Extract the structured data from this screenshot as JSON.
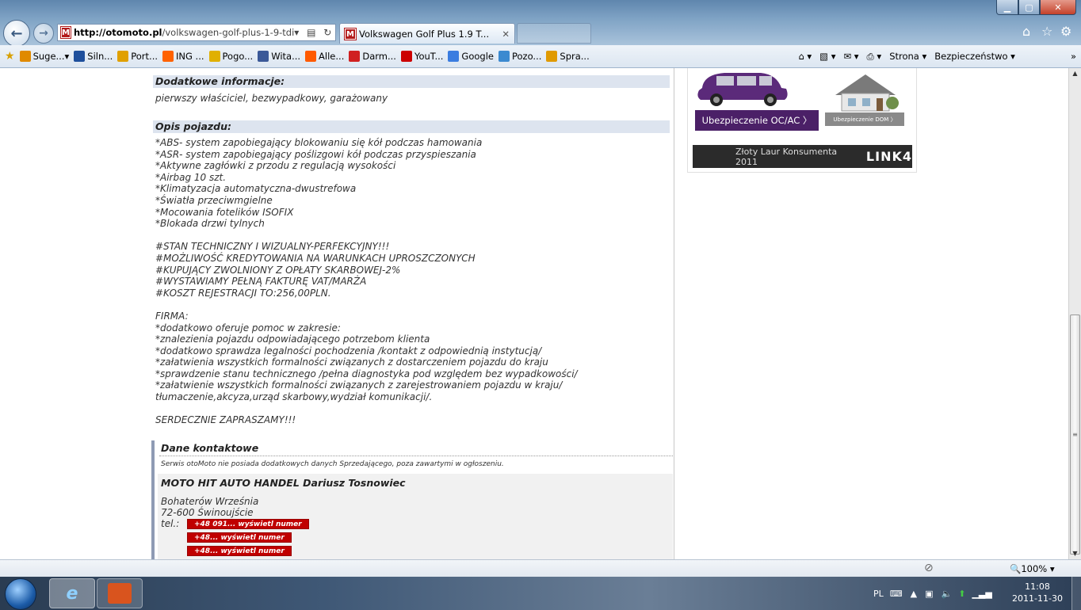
{
  "browser": {
    "url_domain": "http://otomoto.pl",
    "url_path": "/volkswagen-golf-plus-1-9-tdi",
    "tab_title": "Volkswagen Golf Plus 1.9 T...",
    "favorites": [
      {
        "label": "Suge...",
        "icon": "suggested-sites-icon",
        "color": "#e08a00"
      },
      {
        "label": "Siln...",
        "icon": "vw-icon",
        "color": "#1e4f9c"
      },
      {
        "label": "Port...",
        "icon": "int-icon",
        "color": "#e0a000"
      },
      {
        "label": "ING ...",
        "icon": "ing-icon",
        "color": "#ff6200"
      },
      {
        "label": "Pogo...",
        "icon": "weather-icon",
        "color": "#e0b000"
      },
      {
        "label": "Wita...",
        "icon": "facebook-icon",
        "color": "#3b5998"
      },
      {
        "label": "Alle...",
        "icon": "allegro-icon",
        "color": "#ff5a00"
      },
      {
        "label": "Darm...",
        "icon": "bd-icon",
        "color": "#d02020"
      },
      {
        "label": "YouT...",
        "icon": "youtube-icon",
        "color": "#cc0000"
      },
      {
        "label": "Google",
        "icon": "google-icon",
        "color": "#3b7de0"
      },
      {
        "label": "Pozo...",
        "icon": "ie-page-icon",
        "color": "#3b8ad0"
      },
      {
        "label": "Spra...",
        "icon": "check-icon",
        "color": "#e09a00"
      }
    ],
    "cmd_page": "Strona ▾",
    "cmd_security": "Bezpieczeństwo ▾",
    "zoom": "100%"
  },
  "listing": {
    "extra_info_heading": "Dodatkowe informacje:",
    "extra_info_text": "pierwszy właściciel, bezwypadkowy, garażowany",
    "description_heading": "Opis pojazdu:",
    "description_lines": [
      "*ABS- system zapobiegający blokowaniu się kół podczas hamowania",
      "*ASR- system zapobiegający poślizgowi kół podczas przyspieszania",
      "*Aktywne zagłówki z przodu z regulacją wysokości",
      "*Airbag 10 szt.",
      "*Klimatyzacja automatyczna-dwustrefowa",
      "*Światła przeciwmgielne",
      "*Mocowania fotelików ISOFIX",
      "*Blokada drzwi tylnych",
      "",
      "#STAN TECHNICZNY I WIZUALNY-PERFEKCYJNY!!!",
      "#MOŻLIWOŚĆ KREDYTOWANIA NA WARUNKACH UPROSZCZONYCH",
      "#KUPUJĄCY ZWOLNIONY Z OPŁATY SKARBOWEJ-2%",
      "#WYSTAWIAMY PEŁNĄ FAKTURĘ VAT/MARŻA",
      "#KOSZT REJESTRACJI TO:256,00PLN.",
      "",
      "FIRMA:",
      "*dodatkowo oferuje pomoc w zakresie:",
      "*znalezienia pojazdu odpowiadającego potrzebom klienta",
      "*dodatkowo sprawdza legalności pochodzenia /kontakt z odpowiednią instytucją/",
      "*załatwienia wszystkich formalności związanych z dostarczeniem pojazdu do kraju",
      "*sprawdzenie stanu technicznego /pełna diagnostyka pod względem bez wypadkowości/",
      "*załatwienie wszystkich formalności związanych z zarejestrowaniem pojazdu w kraju/",
      "tłumaczenie,akcyza,urząd skarbowy,wydział komunikacji/.",
      "",
      "SERDECZNIE ZAPRASZAMY!!!"
    ]
  },
  "contact": {
    "heading": "Dane kontaktowe",
    "note": "Serwis otoMoto nie posiada dodatkowych danych Sprzedającego, poza zawartymi w ogłoszeniu.",
    "seller": "MOTO HIT AUTO HANDEL Dariusz Tosnowiec",
    "street": "Bohaterów Września",
    "city": "72-600 Świnoujście",
    "tel_label": "tel.:",
    "phones": [
      "+48 091... wyświetl numer",
      "+48... wyświetl numer",
      "+48... wyświetl numer"
    ]
  },
  "ad": {
    "btn_oc": "Ubezpieczenie OC/AC  〉",
    "btn_dom": "Ubezpieczenie  DOM  〉",
    "award": "Złoty Laur Konsumenta 2011",
    "brand": "LINK4"
  },
  "taskbar": {
    "lang": "PL",
    "time": "11:08",
    "date": "2011-11-30"
  }
}
